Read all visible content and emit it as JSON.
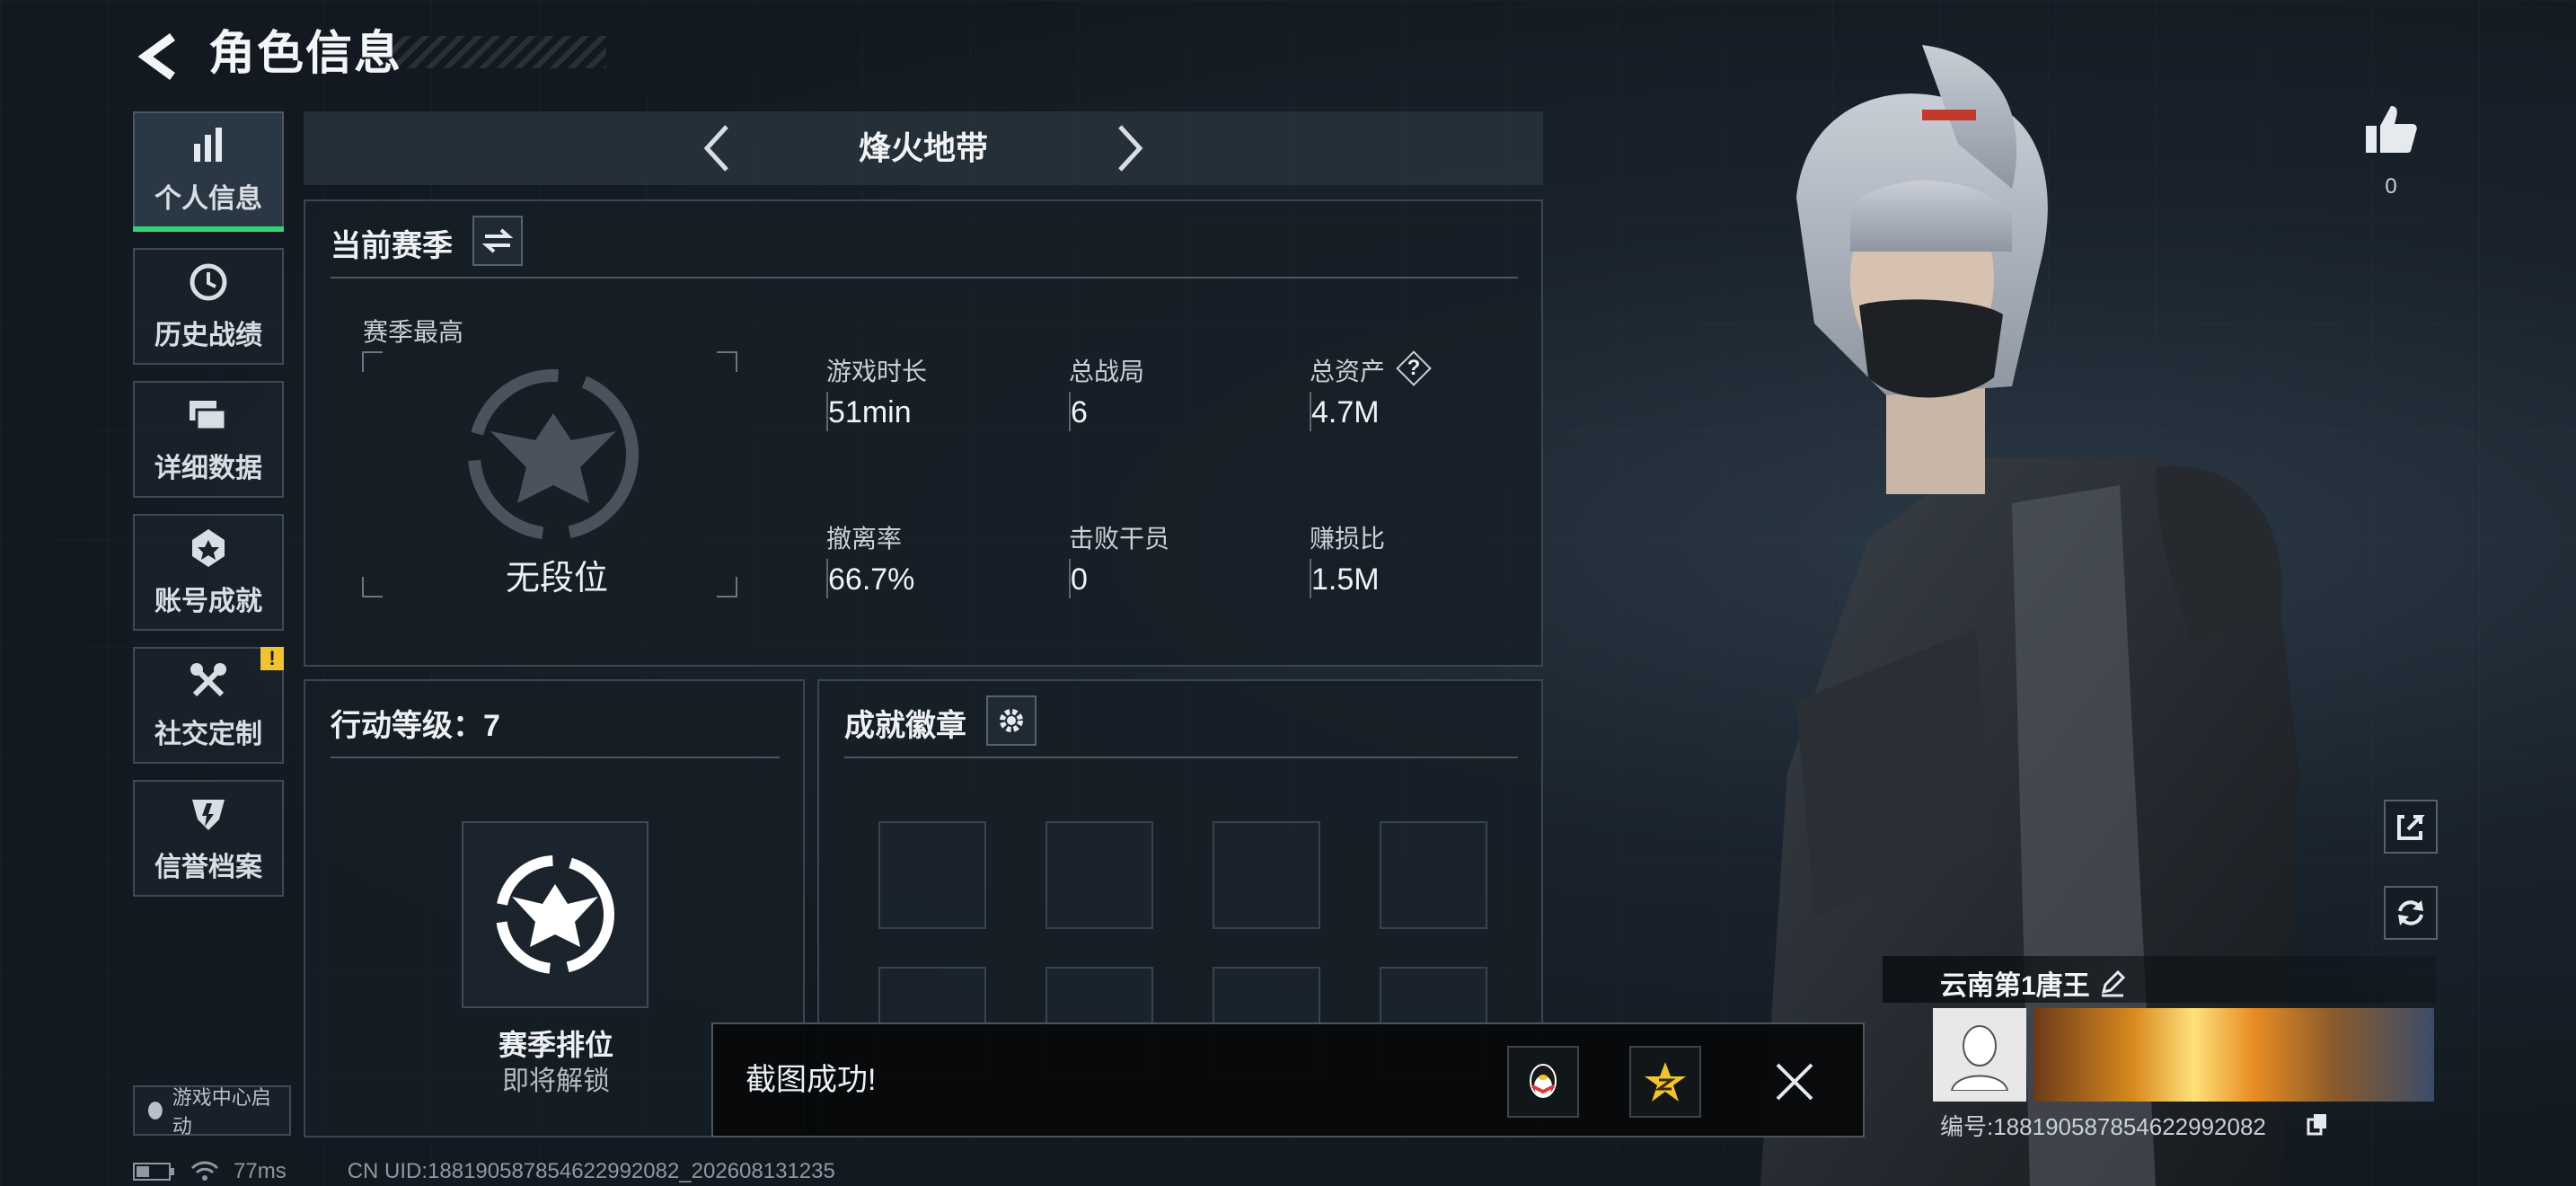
{
  "header": {
    "title": "角色信息"
  },
  "nav": {
    "items": [
      {
        "label": "个人信息",
        "icon": "bar-chart-icon",
        "active": true
      },
      {
        "label": "历史战绩",
        "icon": "history-clock-icon"
      },
      {
        "label": "详细数据",
        "icon": "folder-stack-icon"
      },
      {
        "label": "账号成就",
        "icon": "achievement-medal-icon"
      },
      {
        "label": "社交定制",
        "icon": "tools-icon",
        "badge": "!"
      },
      {
        "label": "信誉档案",
        "icon": "credit-shield-icon"
      }
    ],
    "game_center": "游戏中心启动"
  },
  "mode": {
    "title": "烽火地带"
  },
  "season": {
    "title": "当前赛季",
    "best_label": "赛季最高",
    "rank_label": "无段位",
    "stats": [
      {
        "label": "游戏时长",
        "value": "51min"
      },
      {
        "label": "总战局",
        "value": "6"
      },
      {
        "label": "总资产",
        "value": "4.7M",
        "help": "?"
      },
      {
        "label": "撤离率",
        "value": "66.7%"
      },
      {
        "label": "击败干员",
        "value": "0"
      },
      {
        "label": "赚损比",
        "value": "1.5M"
      }
    ]
  },
  "action": {
    "title": "行动等级：7",
    "rank_title": "赛季排位",
    "rank_sub": "即将解锁"
  },
  "badges": {
    "title": "成就徽章"
  },
  "toast": {
    "message": "截图成功!"
  },
  "likes": {
    "count": "0"
  },
  "player": {
    "name": "云南第1唐王",
    "id": "编号:18819058785462299208​2"
  },
  "status": {
    "ping": "77ms",
    "uid": "CN UID:18819058785462299208​2_20260813​1235"
  },
  "colors": {
    "accent_green": "#2ed573",
    "badge_yellow": "#f2c230",
    "panel_bg": "#161e26"
  }
}
